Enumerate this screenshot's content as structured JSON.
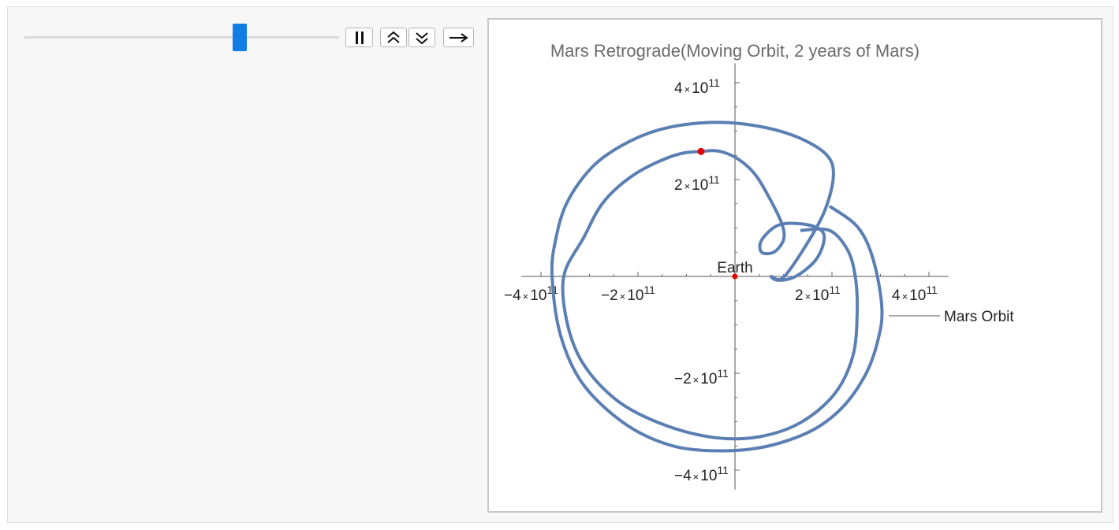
{
  "controls": {
    "slider": {
      "value": 0.685
    },
    "pause_icon": "pause-icon",
    "faster_icon": "double-chevron-up-icon",
    "slower_icon": "double-chevron-down-icon",
    "direction_icon": "arrow-right-icon"
  },
  "chart_data": {
    "type": "line",
    "title": "Mars Retrograde(Moving Orbit, 2 years of Mars)",
    "xlabel": "",
    "ylabel": "",
    "xlim": [
      -440000000000.0,
      440000000000.0
    ],
    "ylim": [
      -440000000000.0,
      440000000000.0
    ],
    "grid": false,
    "legend": "right",
    "x_ticks": [
      {
        "value": -400000000000.0,
        "mantissa": "−4",
        "exp": "11"
      },
      {
        "value": -200000000000.0,
        "mantissa": "−2",
        "exp": "11"
      },
      {
        "value": 200000000000.0,
        "mantissa": "2",
        "exp": "11"
      },
      {
        "value": 400000000000.0,
        "mantissa": "4",
        "exp": "11"
      }
    ],
    "y_ticks": [
      {
        "value": 400000000000.0,
        "mantissa": "4",
        "exp": "11"
      },
      {
        "value": 200000000000.0,
        "mantissa": "2",
        "exp": "11"
      },
      {
        "value": -200000000000.0,
        "mantissa": "−2",
        "exp": "11"
      },
      {
        "value": -400000000000.0,
        "mantissa": "−4",
        "exp": "11"
      }
    ],
    "tick_times": "×",
    "tick_base": "10",
    "earth": {
      "label": "Earth",
      "x": 0,
      "y": 0
    },
    "mars_marker": {
      "x": -70000000000.0,
      "y": 258000000000.0
    },
    "series": [
      {
        "name": "Mars Orbit",
        "color": "#5b7fb3",
        "points": [
          [
            195000000000.0,
            145000000000.0
          ],
          [
            253000000000.0,
            102000000000.0
          ],
          [
            285000000000.0,
            35000000000.0
          ],
          [
            303000000000.0,
            -65000000000.0
          ],
          [
            294000000000.0,
            -135000000000.0
          ],
          [
            268000000000.0,
            -205000000000.0
          ],
          [
            220000000000.0,
            -272000000000.0
          ],
          [
            155000000000.0,
            -320000000000.0
          ],
          [
            60000000000.0,
            -352000000000.0
          ],
          [
            -40000000000.0,
            -360000000000.0
          ],
          [
            -135000000000.0,
            -348000000000.0
          ],
          [
            -230000000000.0,
            -302000000000.0
          ],
          [
            -315000000000.0,
            -220000000000.0
          ],
          [
            -360000000000.0,
            -120000000000.0
          ],
          [
            -377000000000.0,
            0
          ],
          [
            -370000000000.0,
            75000000000.0
          ],
          [
            -345000000000.0,
            155000000000.0
          ],
          [
            -290000000000.0,
            230000000000.0
          ],
          [
            -215000000000.0,
            280000000000.0
          ],
          [
            -135000000000.0,
            308000000000.0
          ],
          [
            -35000000000.0,
            318000000000.0
          ],
          [
            60000000000.0,
            308000000000.0
          ],
          [
            135000000000.0,
            285000000000.0
          ],
          [
            190000000000.0,
            250000000000.0
          ],
          [
            203000000000.0,
            207000000000.0
          ],
          [
            186000000000.0,
            138000000000.0
          ],
          [
            150000000000.0,
            70000000000.0
          ],
          [
            100000000000.0,
            -2000000000.0
          ],
          [
            75000000000.0,
            0
          ],
          [
            90000000000.0,
            -8000000000.0
          ],
          [
            125000000000.0,
            0
          ],
          [
            165000000000.0,
            32000000000.0
          ],
          [
            183000000000.0,
            70000000000.0
          ],
          [
            178000000000.0,
            95000000000.0
          ],
          [
            142000000000.0,
            108000000000.0
          ],
          [
            90000000000.0,
            106000000000.0
          ],
          [
            55000000000.0,
            75000000000.0
          ],
          [
            55000000000.0,
            50000000000.0
          ],
          [
            80000000000.0,
            50000000000.0
          ],
          [
            100000000000.0,
            75000000000.0
          ],
          [
            98000000000.0,
            105000000000.0
          ],
          [
            80000000000.0,
            145000000000.0
          ],
          [
            45000000000.0,
            206000000000.0
          ],
          [
            10000000000.0,
            240000000000.0
          ],
          [
            -30000000000.0,
            258000000000.0
          ],
          [
            -70000000000.0,
            258000000000.0
          ],
          [
            -125000000000.0,
            250000000000.0
          ],
          [
            -205000000000.0,
            212000000000.0
          ],
          [
            -270000000000.0,
            155000000000.0
          ],
          [
            -312000000000.0,
            80000000000.0
          ],
          [
            -353000000000.0,
            0
          ],
          [
            -345000000000.0,
            -100000000000.0
          ],
          [
            -310000000000.0,
            -185000000000.0
          ],
          [
            -238000000000.0,
            -260000000000.0
          ],
          [
            -142000000000.0,
            -308000000000.0
          ],
          [
            -40000000000.0,
            -333000000000.0
          ],
          [
            50000000000.0,
            -331000000000.0
          ],
          [
            135000000000.0,
            -302000000000.0
          ],
          [
            205000000000.0,
            -243000000000.0
          ],
          [
            243000000000.0,
            -165000000000.0
          ],
          [
            252000000000.0,
            -75000000000.0
          ],
          [
            248000000000.0,
            0
          ],
          [
            232000000000.0,
            55000000000.0
          ],
          [
            195000000000.0,
            95000000000.0
          ],
          [
            135000000000.0,
            95000000000.0
          ]
        ]
      }
    ]
  }
}
